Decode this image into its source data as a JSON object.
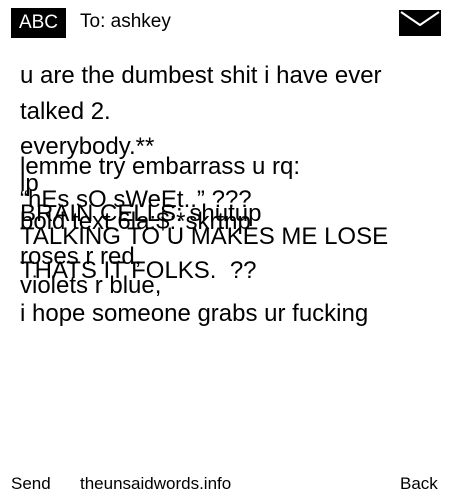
{
  "header": {
    "input_mode": "ABC",
    "recipient": "To: ashkey",
    "icon": "envelope-icon"
  },
  "message": {
    "lines": [
      "u are the dumbest shit i have ever",
      "talked 2.",
      "everybody.**",
      "lemme try embarrass u rq:",
      "lp",
      "“hEs sO sWeEt..” ???",
      "BRAIN CELLS: shutup",
      "bold text 6la:$:*skrtnp",
      "TALKING TO U MAKES ME LOSE",
      "roses r red,",
      "THATS IT FOLKS.  ??",
      "violets r blue,",
      "i hope someone grabs ur fucking"
    ]
  },
  "footer": {
    "send_label": "Send",
    "site_label": "theunsaidwords.info",
    "back_label": "Back"
  }
}
